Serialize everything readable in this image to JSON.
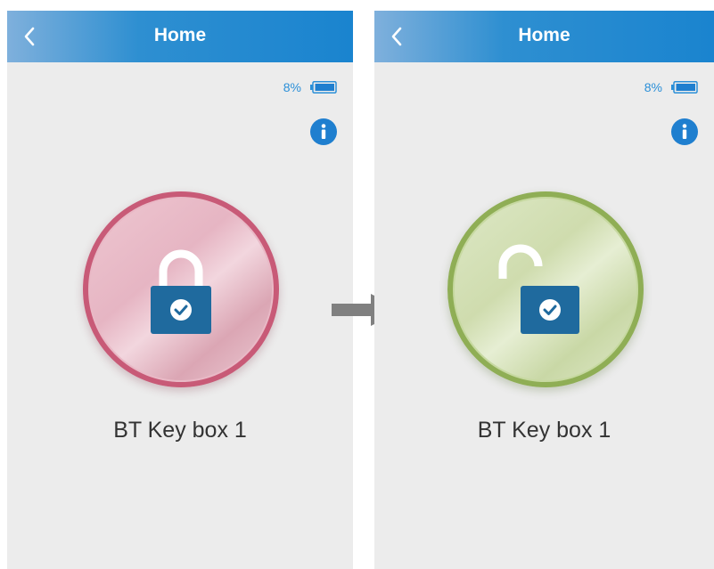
{
  "colors": {
    "header_blue": "#1a84cf",
    "accent_blue": "#2a8fd8",
    "locked_ring": "#c85a77",
    "unlocked_ring": "#8fae55",
    "lock_body": "#1f6a9e",
    "arrow_gray": "#808080"
  },
  "screens": [
    {
      "state": "locked",
      "header": {
        "title": "Home",
        "back_icon": "chevron-left-icon"
      },
      "battery": {
        "percent_text": "8%",
        "level": 0.08,
        "icon": "battery-icon"
      },
      "info_icon": "info-icon",
      "lock_icon": "lock-closed-icon",
      "device_name": "BT Key box 1"
    },
    {
      "state": "unlocked",
      "header": {
        "title": "Home",
        "back_icon": "chevron-left-icon"
      },
      "battery": {
        "percent_text": "8%",
        "level": 0.08,
        "icon": "battery-icon"
      },
      "info_icon": "info-icon",
      "lock_icon": "lock-open-icon",
      "device_name": "BT Key box 1"
    }
  ],
  "transition_icon": "arrow-right-icon"
}
